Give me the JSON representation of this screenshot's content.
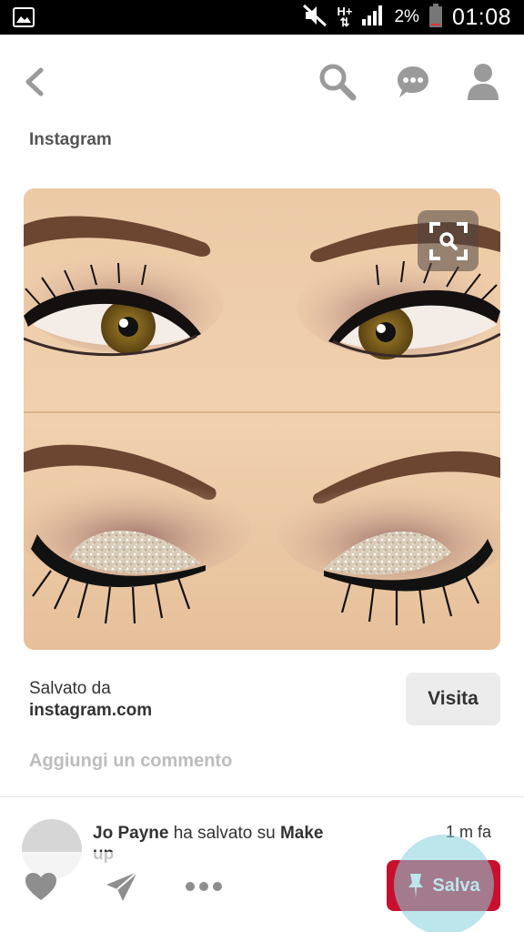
{
  "status_bar": {
    "network_type": "H+",
    "battery_percent": "2%",
    "time": "01:08"
  },
  "header": {
    "icons": [
      "back-arrow-icon",
      "search-icon",
      "chat-icon",
      "profile-icon"
    ]
  },
  "pin": {
    "source": "Instagram",
    "image_alt_subject": "eye makeup",
    "saved_from_label": "Salvato da",
    "saved_from_domain": "instagram.com",
    "visit_label": "Visita",
    "comment_placeholder": "Aggiungi un commento"
  },
  "activity": {
    "user": "Jo Payne",
    "action": " ha salvato su ",
    "board": "Make",
    "board_rest": "up",
    "time": "1 m fa"
  },
  "actions": {
    "save_label": "Salva",
    "icons": [
      "heart-icon",
      "send-icon",
      "more-icon",
      "pin-icon"
    ]
  },
  "colors": {
    "brand_red": "#c8102e",
    "icon_gray": "#9a9a9a"
  }
}
